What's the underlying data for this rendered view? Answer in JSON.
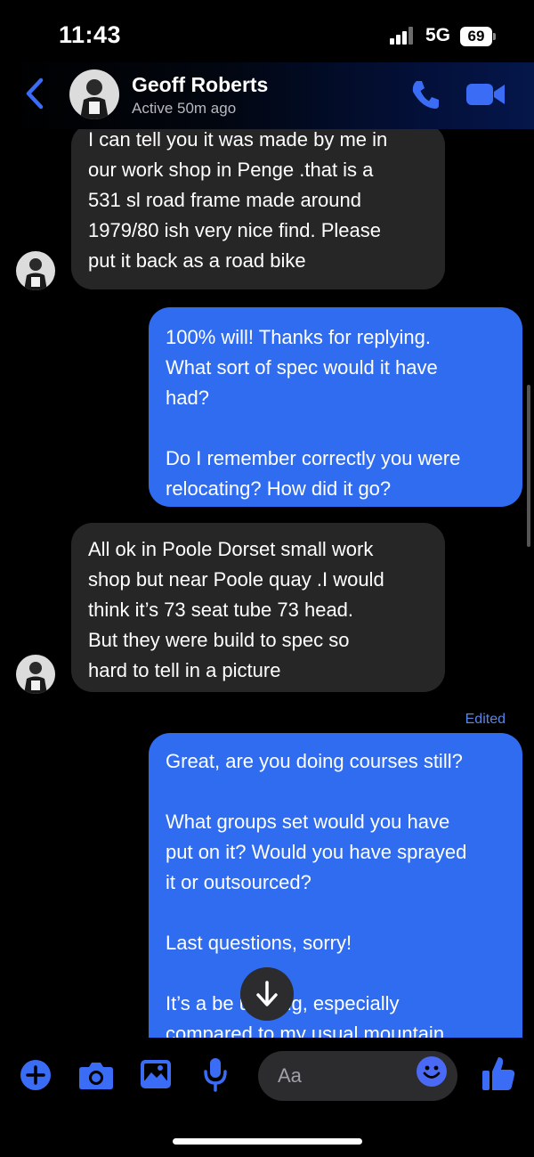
{
  "status_bar": {
    "time": "11:43",
    "network": "5G",
    "battery": "69"
  },
  "header": {
    "contact_name": "Geoff Roberts",
    "contact_status": "Active 50m ago"
  },
  "messages": [
    {
      "text": "I can tell you it was made by me in\nour work shop in Penge .that is a\n531 sl road frame made around\n1979/80 ish very nice find. Please\nput it back as a road bike"
    },
    {
      "text": "100% will! Thanks for replying.\nWhat sort of spec would it have\nhad?\n\nDo I remember correctly you were\nrelocating? How did it go?"
    },
    {
      "text": "All ok in Poole Dorset small work\nshop but near Poole quay .I would\nthink it’s 73 seat tube 73 head.\nBut they were build to spec so\nhard to tell in a picture"
    },
    {
      "text": "Great, are you doing courses still?\n\nWhat groups set would you have\nput on it? Would you have sprayed\nit or outsourced?\n\nLast questions, sorry!\n\nIt’s a be      ul thing, especially\ncompared to my usual mountain",
      "edited_label": "Edited"
    }
  ],
  "composer": {
    "placeholder": "Aa"
  },
  "colors": {
    "accent": "#3b6cf6",
    "outgoing_bubble": "#2f6cf0",
    "incoming_bubble": "#262626",
    "background": "#000000"
  },
  "icons": [
    "back-chevron-icon",
    "phone-icon",
    "video-camera-icon",
    "plus-icon",
    "camera-icon",
    "image-icon",
    "microphone-icon",
    "smiley-icon",
    "thumbs-up-icon",
    "arrow-down-icon"
  ]
}
